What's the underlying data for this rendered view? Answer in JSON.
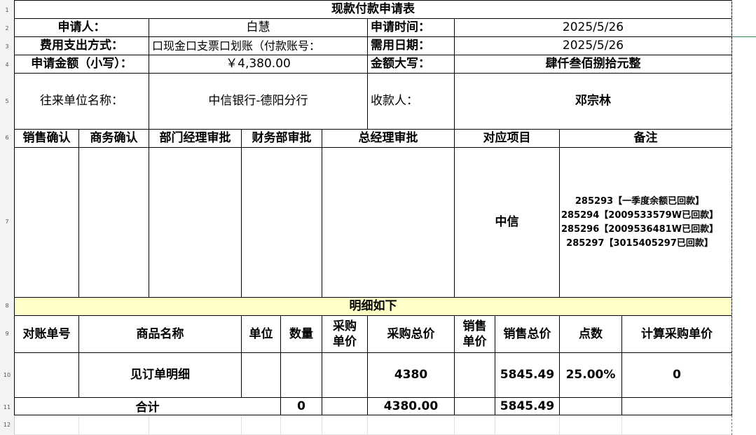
{
  "row_numbers": [
    "1",
    "2",
    "3",
    "4",
    "5",
    "6",
    "7",
    "8",
    "9",
    "10",
    "11",
    "12"
  ],
  "form": {
    "title": "现款付款申请表",
    "applicant_label": "申请人：",
    "applicant_value": "白慧",
    "apply_time_label": "申请时间：",
    "apply_time_value": "2025/5/26",
    "expense_method_label": "费用支出方式：",
    "expense_method_value": "口现金口支票口划账（付款账号：",
    "need_date_label": "需用日期：",
    "need_date_value": "2025/5/26",
    "amount_small_label": "申请金额（小写）：",
    "amount_small_value": "￥4,380.00",
    "amount_big_label": "金额大写：",
    "amount_big_value": "肆仟叁佰捌拾元整",
    "counterparty_label": "往来单位名称：",
    "counterparty_value": "中信银行-德阳分行",
    "payee_label": "收款人：",
    "payee_value": "邓宗林"
  },
  "approvals": {
    "headers": [
      "销售确认",
      "商务确认",
      "部门经理审批",
      "财务部审批",
      "总经理审批",
      "对应项目",
      "备注"
    ],
    "project_value": "中信",
    "remarks": [
      "285293【一季度余额已回款】",
      "285294【2009533579W已回款】",
      "285296【2009536481W已回款】",
      "285297【3015405297已回款】"
    ]
  },
  "details": {
    "title": "明细如下",
    "headers": [
      "对账单号",
      "商品名称",
      "单位",
      "数量",
      "采购单价",
      "采购总价",
      "销售单价",
      "销售总价",
      "点数",
      "计算采购单价"
    ],
    "row": {
      "statement_no": "",
      "product_name": "见订单明细",
      "unit": "",
      "quantity": "",
      "purchase_unit_price": "",
      "purchase_total": "4380",
      "sales_unit_price": "",
      "sales_total": "5845.49",
      "points": "25.00%",
      "calc_purchase_unit_price": "0"
    },
    "total": {
      "label": "合计",
      "quantity": "0",
      "purchase_total": "4380.00",
      "sales_total": "5845.49"
    }
  },
  "colors": {
    "highlight": "#ffffc8",
    "grid": "#e0e0e0",
    "border": "#000000",
    "header_bg": "#f3f3f3"
  }
}
